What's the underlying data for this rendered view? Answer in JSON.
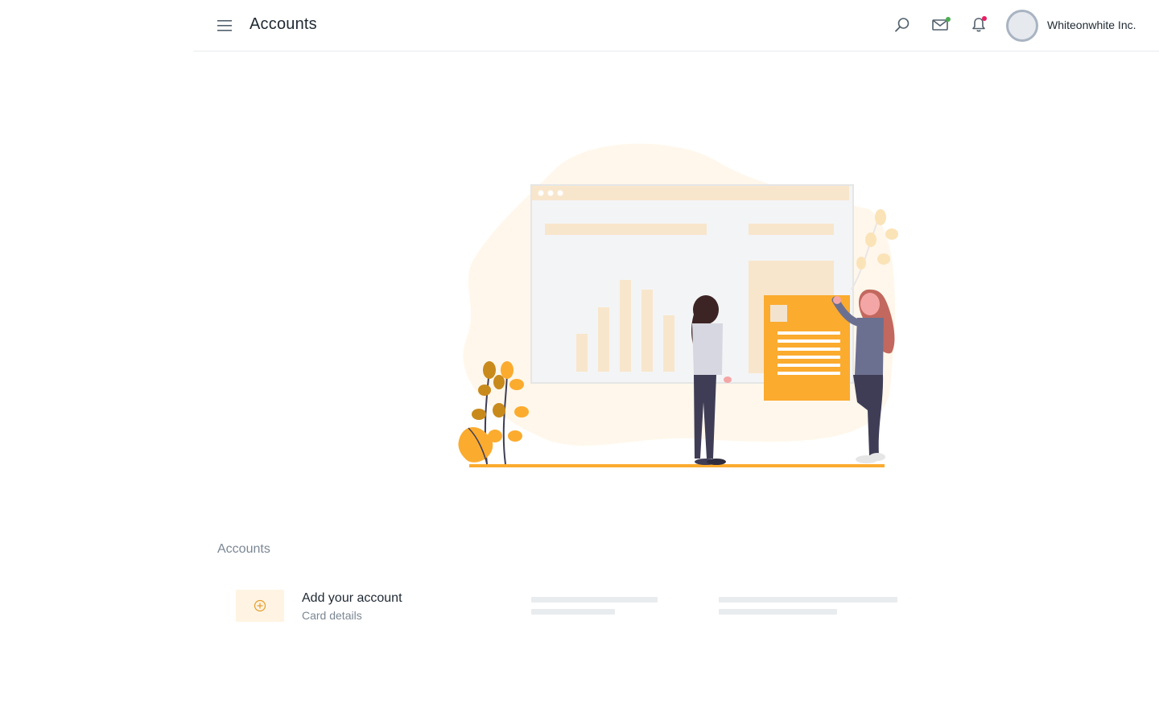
{
  "header": {
    "title": "Accounts",
    "company_name": "Whiteonwhite Inc.",
    "icons": {
      "menu": "hamburger-menu-icon",
      "search": "search-icon",
      "mail": "mail-icon",
      "notifications": "bell-icon"
    },
    "mail_badge_color": "#4caf50",
    "notification_badge_color": "#e91e63"
  },
  "section": {
    "label": "Accounts"
  },
  "account": {
    "title": "Add your account",
    "subtitle": "Card details",
    "icon": "add-circle-icon"
  },
  "colors": {
    "accent": "#fbab2e",
    "accent_light": "#fff4e3",
    "muted_text": "#7b8794",
    "skeleton": "#e9ecef"
  }
}
